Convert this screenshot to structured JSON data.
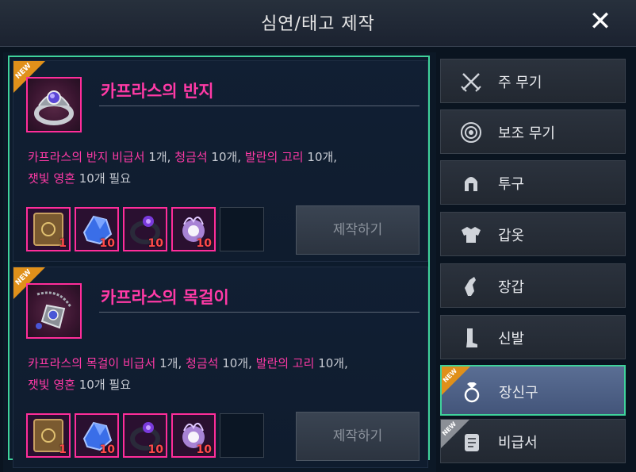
{
  "header": {
    "title": "심연/태고 제작",
    "close_icon": "close-icon"
  },
  "recipes": [
    {
      "badge": "NEW",
      "name": "카프라스의 반지",
      "icon": "ring-icon",
      "requirements": {
        "m1_name": "카프라스의 반지 비급서",
        "m1_qty": "1개, ",
        "m2_name": "청금석",
        "m2_qty": "10개, ",
        "m3_name": "발란의 고리",
        "m3_qty": "10개,",
        "m4_name": "잿빛 영혼",
        "m4_qty": "10개 필요"
      },
      "materials": [
        {
          "icon": "book-icon",
          "qty": "1"
        },
        {
          "icon": "blue-crystal-icon",
          "qty": "10"
        },
        {
          "icon": "dark-ring-icon",
          "qty": "10"
        },
        {
          "icon": "soul-flame-icon",
          "qty": "10"
        }
      ],
      "craft_label": "제작하기"
    },
    {
      "badge": "NEW",
      "name": "카프라스의 목걸이",
      "icon": "necklace-icon",
      "requirements": {
        "m1_name": "카프라스의 목걸이 비급서",
        "m1_qty": "1개, ",
        "m2_name": "청금석",
        "m2_qty": "10개, ",
        "m3_name": "발란의 고리",
        "m3_qty": "10개,",
        "m4_name": "잿빛 영혼",
        "m4_qty": "10개 필요"
      },
      "materials": [
        {
          "icon": "book-icon",
          "qty": "1"
        },
        {
          "icon": "blue-crystal-icon",
          "qty": "10"
        },
        {
          "icon": "dark-ring-icon",
          "qty": "10"
        },
        {
          "icon": "soul-flame-icon",
          "qty": "10"
        }
      ],
      "craft_label": "제작하기"
    }
  ],
  "sidebar": {
    "items": [
      {
        "label": "주 무기",
        "icon": "crossed-swords-icon"
      },
      {
        "label": "보조 무기",
        "icon": "target-icon"
      },
      {
        "label": "투구",
        "icon": "helmet-icon"
      },
      {
        "label": "갑옷",
        "icon": "armor-icon"
      },
      {
        "label": "장갑",
        "icon": "glove-icon"
      },
      {
        "label": "신발",
        "icon": "boot-icon"
      },
      {
        "label": "장신구",
        "icon": "accessory-icon",
        "badge": "NEW"
      },
      {
        "label": "비급서",
        "icon": "scroll-icon",
        "badge": "NEW"
      }
    ]
  },
  "colors": {
    "accent": "#3fd29b",
    "highlight": "#ff3aa6",
    "badge": "#e0901a"
  }
}
